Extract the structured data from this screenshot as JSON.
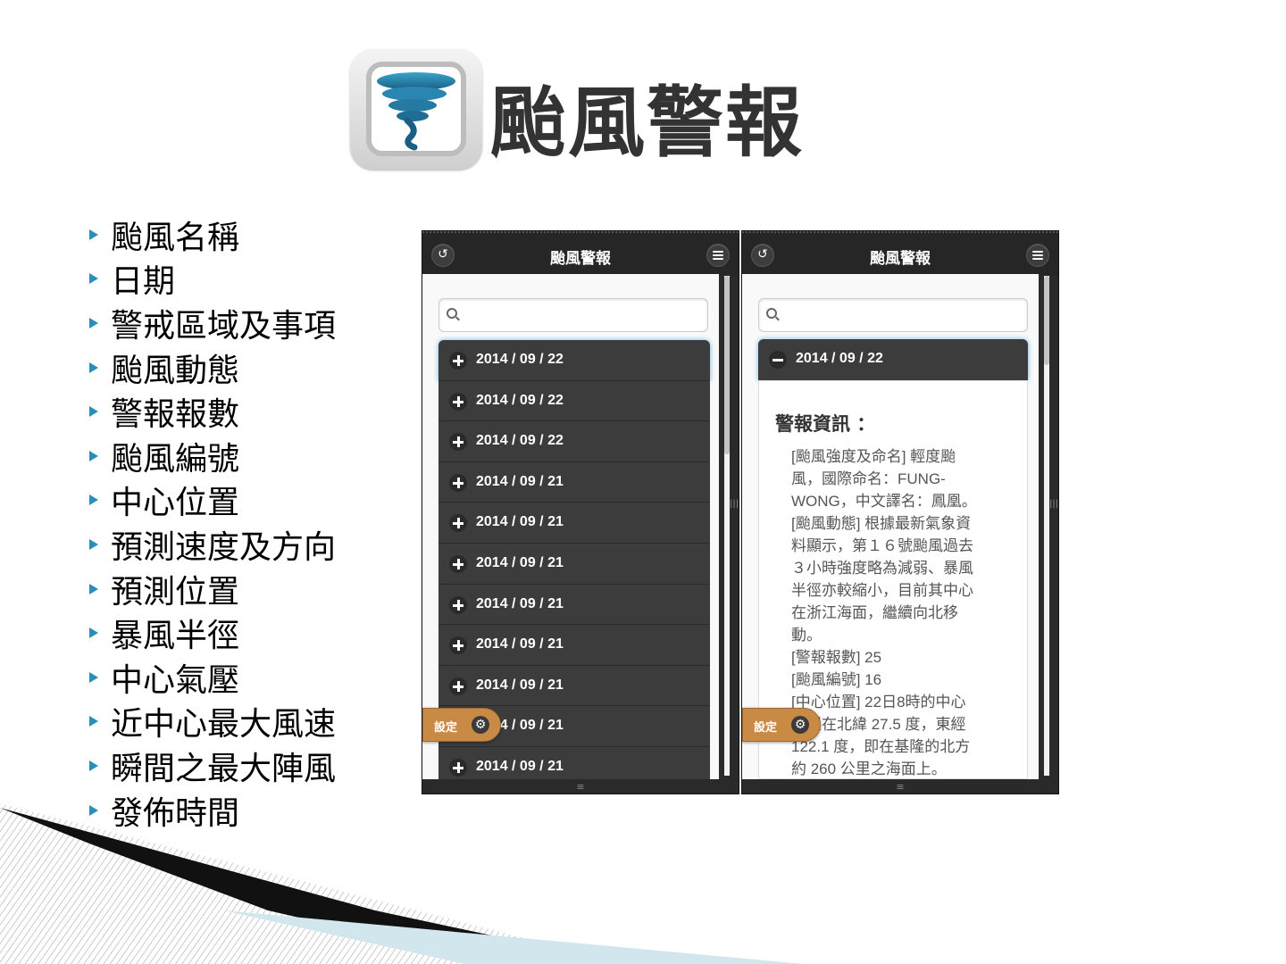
{
  "header": {
    "title": "颱風警報"
  },
  "features": [
    "颱風名稱",
    "日期",
    "警戒區域及事項",
    "颱風動態",
    "警報報數",
    "颱風編號",
    "中心位置",
    "預測速度及方向",
    "預測位置",
    "暴風半徑",
    "中心氣壓",
    "近中心最大風速",
    "瞬間之最大陣風",
    "發佈時間"
  ],
  "left_phone": {
    "title": "颱風警報",
    "dates": [
      "2014 / 09 / 22",
      "2014 / 09 / 22",
      "2014 / 09 / 22",
      "2014 / 09 / 21",
      "2014 / 09 / 21",
      "2014 / 09 / 21",
      "2014 / 09 / 21",
      "2014 / 09 / 21",
      "2014 / 09 / 21",
      "2014 / 09 / 21",
      "2014 / 09 / 21"
    ],
    "settings_label": "設定"
  },
  "right_phone": {
    "title": "颱風警報",
    "expanded_date": "2014 / 09 / 22",
    "info_title": "警報資訊 ：",
    "info_lines": [
      "[颱風強度及命名] 輕度颱",
      "風，國際命名：FUNG-",
      "WONG，中文譯名：鳳凰。",
      "[颱風動態] 根據最新氣象資",
      "料顯示，第１６號颱風過去",
      "３小時強度略為減弱、暴風",
      "半徑亦較縮小，目前其中心",
      "在浙江海面，繼續向北移",
      "動。",
      "[警報報數] 25",
      "[颱風編號] 16",
      "[中心位置] 22日8時的中心",
      "位置在北緯 27.5 度，東經",
      "122.1 度，即在基隆的北方",
      "約 260 公里之海面上。"
    ],
    "settings_label": "設定"
  },
  "icons": {
    "back": "back-arrow-icon",
    "menu": "hamburger-menu-icon",
    "search": "search-icon",
    "settings": "gear-icon",
    "expand": "plus-icon",
    "collapse": "minus-icon",
    "logo": "tornado-icon"
  },
  "colors": {
    "accent": "#2b8db9",
    "header_bg": "#262626",
    "settings_btn": "#c98a46",
    "row_bg": "#3c3c3c"
  }
}
